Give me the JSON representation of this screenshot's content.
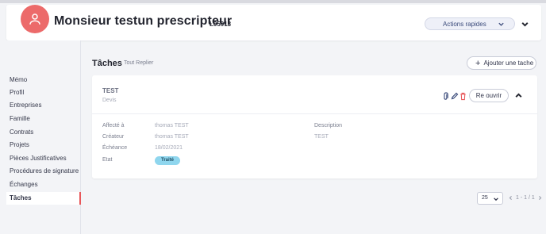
{
  "header": {
    "title": "Monsieur testun prescripteur",
    "code": "L05913",
    "quick_actions_label": "Actions rapides"
  },
  "sidebar": {
    "items": [
      {
        "label": "Mémo"
      },
      {
        "label": "Profil"
      },
      {
        "label": "Entreprises"
      },
      {
        "label": "Famille"
      },
      {
        "label": "Contrats"
      },
      {
        "label": "Projets"
      },
      {
        "label": "Pièces Justificatives"
      },
      {
        "label": "Procédures de signature"
      },
      {
        "label": "Échanges"
      },
      {
        "label": "Tâches",
        "active": true
      }
    ]
  },
  "main": {
    "title": "Tâches",
    "collapse_all": "Tout Replier",
    "add_task": "Ajouter une tache"
  },
  "task": {
    "name": "TEST",
    "type": "Devis",
    "reopen_label": "Re ouvrir",
    "fields": {
      "assigned_label": "Affecté à",
      "assigned_value": "thomas TEST",
      "creator_label": "Créateur",
      "creator_value": "thomas TEST",
      "due_label": "Échéance",
      "due_value": "18/02/2021",
      "state_label": "Etat",
      "state_value": "Traité",
      "description_label": "Description",
      "description_value": "TEST"
    }
  },
  "pagination": {
    "page_size": "25",
    "range": "1 - 1 / 1"
  },
  "colors": {
    "avatar": "#ec6a6a",
    "active_indicator": "#e8575a",
    "status_pill": "#8fd6ee",
    "delete_icon": "#e8575a",
    "edit_icon": "#3a4a7a"
  },
  "icons": {
    "avatar": "user-icon",
    "quick_actions": "chevron-down-icon",
    "header_collapse": "chevron-down-icon",
    "add": "plus-icon",
    "attachment": "paperclip-icon",
    "edit": "pencil-icon",
    "delete": "trash-icon",
    "card_collapse": "chevron-up-icon",
    "pager_prev": "chevron-left-icon",
    "pager_next": "chevron-right-icon"
  }
}
